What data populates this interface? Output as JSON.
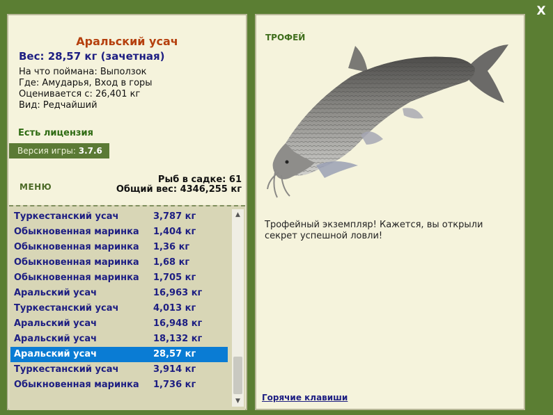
{
  "window": {
    "close_label": "X"
  },
  "catch": {
    "name": "Аральский усач",
    "weight": "Вес: 28,57 кг (зачетная)",
    "bait": "На что поймана: Выползок",
    "place": "Где: Амударья, Вход в горы",
    "value": "Оценивается с: 26,401 кг",
    "rarity": "Вид: Редчайший"
  },
  "license": "Есть лицензия",
  "version": {
    "label": "Версия игры:",
    "value": "3.7.6"
  },
  "menu_label": "МЕНЮ",
  "keepnet": {
    "count": "Рыб в садке: 61",
    "total": "Общий вес: 4346,255 кг"
  },
  "fish_list": [
    {
      "name": "Туркестанский усач",
      "weight": "3,787 кг"
    },
    {
      "name": "Обыкновенная маринка",
      "weight": "1,404 кг"
    },
    {
      "name": "Обыкновенная маринка",
      "weight": "1,36 кг"
    },
    {
      "name": "Обыкновенная маринка",
      "weight": "1,68 кг"
    },
    {
      "name": "Обыкновенная маринка",
      "weight": "1,705 кг"
    },
    {
      "name": "Аральский усач",
      "weight": "16,963 кг"
    },
    {
      "name": "Туркестанский усач",
      "weight": "4,013 кг"
    },
    {
      "name": "Аральский усач",
      "weight": "16,948 кг"
    },
    {
      "name": "Аральский усач",
      "weight": "18,132 кг"
    },
    {
      "name": "Аральский усач",
      "weight": "28,57 кг"
    },
    {
      "name": "Туркестанский усач",
      "weight": "3,914 кг"
    },
    {
      "name": "Обыкновенная маринка",
      "weight": "1,736 кг"
    }
  ],
  "selected_index": 9,
  "trophy": {
    "label": "ТРОФЕЙ",
    "message": "Трофейный экземпляр! Кажется, вы открыли секрет успешной ловли!"
  },
  "hotkeys_label": "Горячие клавиши",
  "icons": {
    "close": "close-icon",
    "scroll_up": "scroll-up-arrow-icon",
    "scroll_down": "scroll-down-arrow-icon"
  },
  "colors": {
    "frame": "#5b7e33",
    "panel": "#f5f3dc",
    "list_bg": "#d8d6b6",
    "selected": "#0a7cd4",
    "fish_name": "#b5400e",
    "list_text": "#1d1e82",
    "license": "#2e6b12"
  }
}
